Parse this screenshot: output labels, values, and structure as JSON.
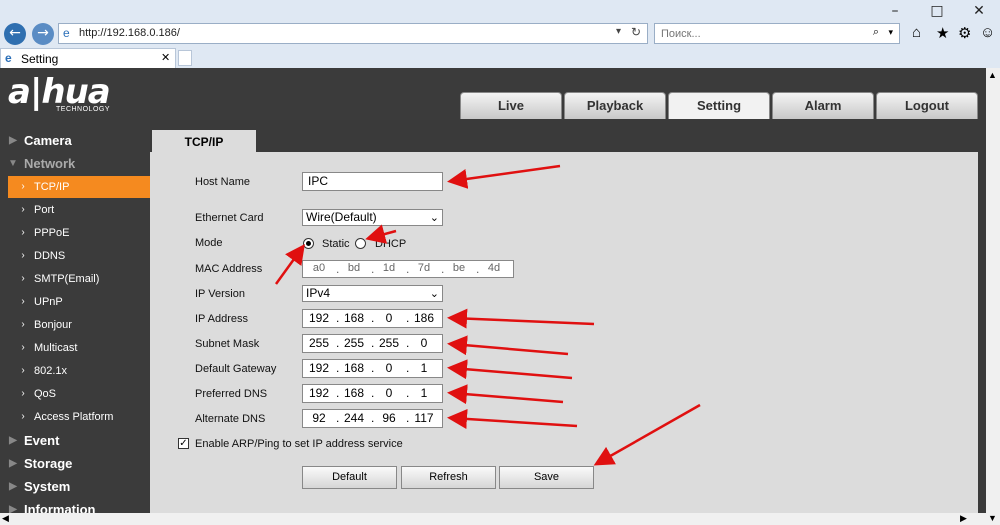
{
  "browser": {
    "url": "http://192.168.0.186/",
    "search_placeholder": "Поиск...",
    "tab_title": "Setting"
  },
  "brand": {
    "logo": "a|hua",
    "logo_sub": "TECHNOLOGY"
  },
  "nav_tabs": [
    {
      "label": "Live"
    },
    {
      "label": "Playback"
    },
    {
      "label": "Setting"
    },
    {
      "label": "Alarm"
    },
    {
      "label": "Logout"
    }
  ],
  "sidebar": {
    "camera": "Camera",
    "network": "Network",
    "items": [
      {
        "label": "TCP/IP"
      },
      {
        "label": "Port"
      },
      {
        "label": "PPPoE"
      },
      {
        "label": "DDNS"
      },
      {
        "label": "SMTP(Email)"
      },
      {
        "label": "UPnP"
      },
      {
        "label": "Bonjour"
      },
      {
        "label": "Multicast"
      },
      {
        "label": "802.1x"
      },
      {
        "label": "QoS"
      },
      {
        "label": "Access Platform"
      }
    ],
    "event": "Event",
    "storage": "Storage",
    "system": "System",
    "information": "Information"
  },
  "content": {
    "tab": "TCP/IP",
    "host_name_label": "Host Name",
    "host_name_value": "IPC",
    "ethernet_label": "Ethernet Card",
    "ethernet_value": "Wire(Default)",
    "mode_label": "Mode",
    "mode_static": "Static",
    "mode_dhcp": "DHCP",
    "mac_label": "MAC Address",
    "mac": [
      "a0",
      "bd",
      "1d",
      "7d",
      "be",
      "4d"
    ],
    "ipver_label": "IP Version",
    "ipver_value": "IPv4",
    "ip_label": "IP Address",
    "ip": [
      "192",
      "168",
      "0",
      "186"
    ],
    "mask_label": "Subnet Mask",
    "mask": [
      "255",
      "255",
      "255",
      "0"
    ],
    "gw_label": "Default Gateway",
    "gw": [
      "192",
      "168",
      "0",
      "1"
    ],
    "dns1_label": "Preferred DNS",
    "dns1": [
      "192",
      "168",
      "0",
      "1"
    ],
    "dns2_label": "Alternate DNS",
    "dns2": [
      "92",
      "244",
      "96",
      "117"
    ],
    "arp_label": "Enable ARP/Ping to set IP address service",
    "btn_default": "Default",
    "btn_refresh": "Refresh",
    "btn_save": "Save"
  },
  "colors": {
    "accent": "#f58a1f",
    "arrow": "#e01010"
  }
}
